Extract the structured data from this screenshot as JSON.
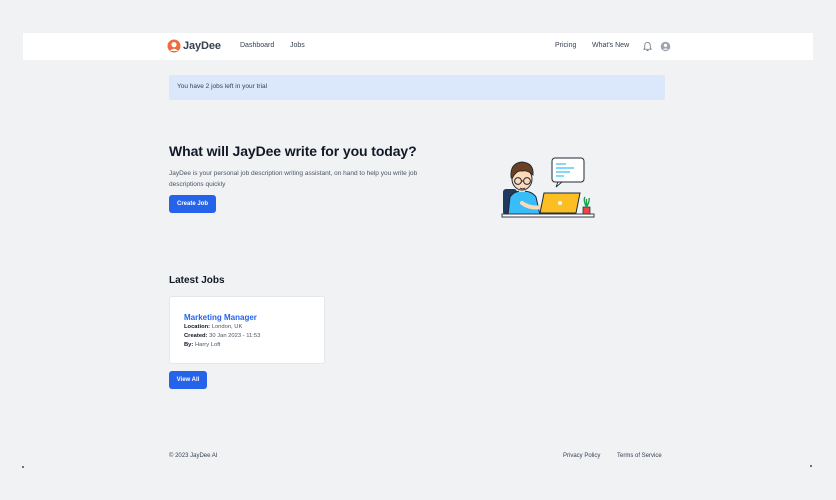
{
  "nav": {
    "brand": "JayDee",
    "links": [
      "Dashboard",
      "Jobs"
    ],
    "right_links": [
      "Pricing",
      "What's New"
    ],
    "icons": [
      "bell-icon",
      "user-avatar-icon"
    ]
  },
  "banner": {
    "text": "You have 2 jobs left in your trial"
  },
  "hero": {
    "title": "What will JayDee write for you today?",
    "description": "JayDee is your personal job description writing assistant, on hand to help you write job descriptions quickly",
    "button": "Create Job"
  },
  "latest": {
    "title": "Latest Jobs",
    "jobs": [
      {
        "title": "Marketing Manager",
        "location_label": "Location:",
        "location": "London, UK",
        "created_label": "Created:",
        "created": "30 Jan 2023 - 11:53",
        "by_label": "By:",
        "by": "Harry Loft"
      }
    ],
    "view_all": "View All"
  },
  "footer": {
    "copyright": "© 2023 JayDee AI",
    "links": [
      "Privacy Policy",
      "Terms of Service"
    ]
  },
  "colors": {
    "accent": "#2563eb",
    "banner_bg": "#dbe7fb",
    "page_bg": "#f1f2f4",
    "logo_orange": "#f26b3a"
  }
}
